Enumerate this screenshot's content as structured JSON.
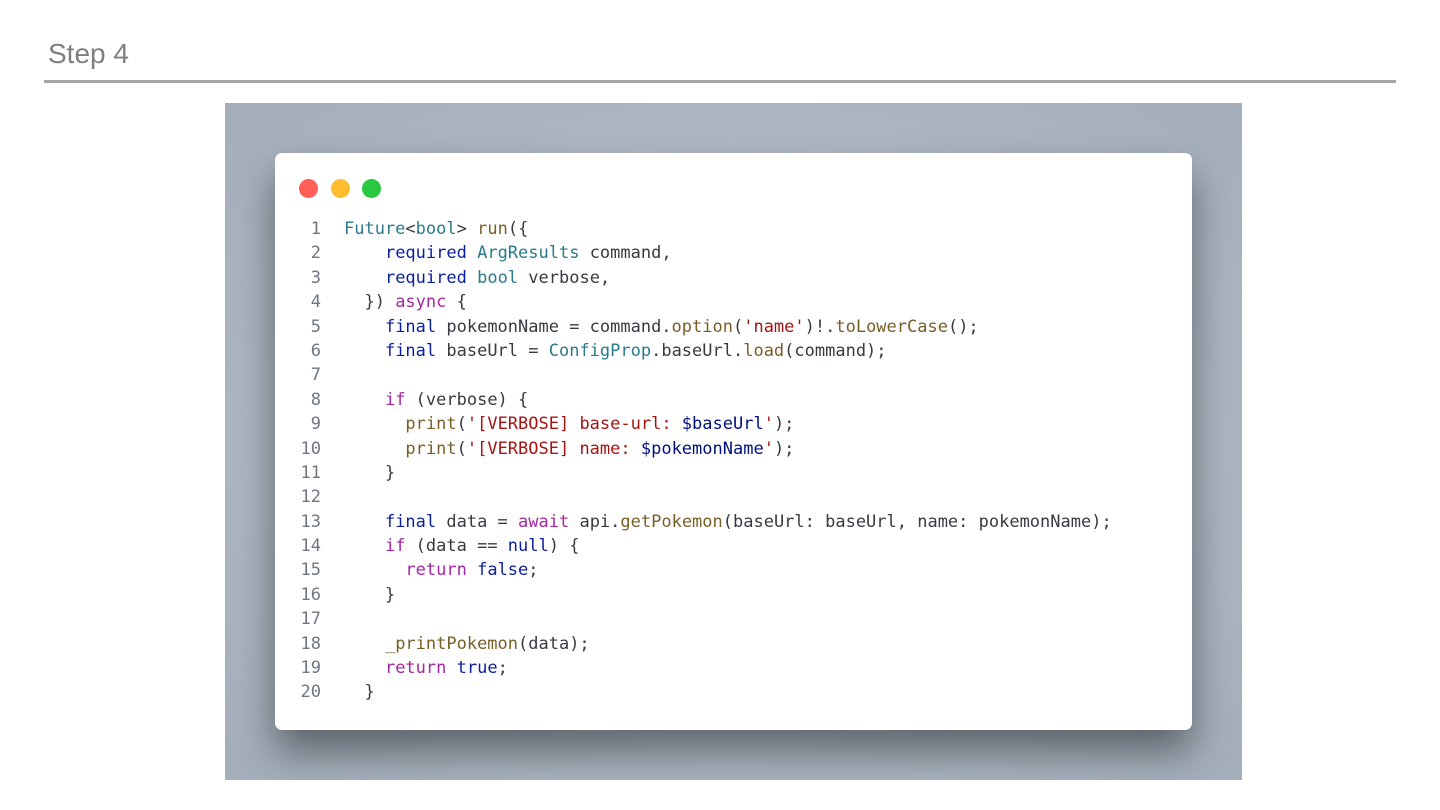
{
  "slide": {
    "title": "Step 4"
  },
  "window": {
    "controls": {
      "close": "#ff5f57",
      "minimize": "#febc2e",
      "maximize": "#28c840"
    }
  },
  "code": {
    "language": "dart",
    "lines": [
      {
        "n": "1",
        "t": [
          [
            "t",
            "Future"
          ],
          [
            "p",
            "<"
          ],
          [
            "t",
            "bool"
          ],
          [
            "p",
            "> "
          ],
          [
            "f",
            "run"
          ],
          [
            "p",
            "({"
          ]
        ]
      },
      {
        "n": "2",
        "t": [
          [
            "p",
            "    "
          ],
          [
            "kb",
            "required"
          ],
          [
            "p",
            " "
          ],
          [
            "t",
            "ArgResults"
          ],
          [
            "p",
            " command,"
          ]
        ]
      },
      {
        "n": "3",
        "t": [
          [
            "p",
            "    "
          ],
          [
            "kb",
            "required"
          ],
          [
            "p",
            " "
          ],
          [
            "t",
            "bool"
          ],
          [
            "p",
            " verbose,"
          ]
        ]
      },
      {
        "n": "4",
        "t": [
          [
            "p",
            "  }) "
          ],
          [
            "k",
            "async"
          ],
          [
            "p",
            " {"
          ]
        ]
      },
      {
        "n": "5",
        "t": [
          [
            "p",
            "    "
          ],
          [
            "kb",
            "final"
          ],
          [
            "p",
            " pokemonName = command."
          ],
          [
            "f",
            "option"
          ],
          [
            "p",
            "("
          ],
          [
            "s",
            "'name'"
          ],
          [
            "p",
            ")!."
          ],
          [
            "f",
            "toLowerCase"
          ],
          [
            "p",
            "();"
          ]
        ]
      },
      {
        "n": "6",
        "t": [
          [
            "p",
            "    "
          ],
          [
            "kb",
            "final"
          ],
          [
            "p",
            " baseUrl = "
          ],
          [
            "t",
            "ConfigProp"
          ],
          [
            "p",
            ".baseUrl."
          ],
          [
            "f",
            "load"
          ],
          [
            "p",
            "(command);"
          ]
        ]
      },
      {
        "n": "7",
        "t": []
      },
      {
        "n": "8",
        "t": [
          [
            "p",
            "    "
          ],
          [
            "k",
            "if"
          ],
          [
            "p",
            " (verbose) {"
          ]
        ]
      },
      {
        "n": "9",
        "t": [
          [
            "p",
            "      "
          ],
          [
            "f",
            "print"
          ],
          [
            "p",
            "("
          ],
          [
            "s",
            "'[VERBOSE] base-url: "
          ],
          [
            "v",
            "$baseUrl"
          ],
          [
            "s",
            "'"
          ],
          [
            "p",
            ");"
          ]
        ]
      },
      {
        "n": "10",
        "t": [
          [
            "p",
            "      "
          ],
          [
            "f",
            "print"
          ],
          [
            "p",
            "("
          ],
          [
            "s",
            "'[VERBOSE] name: "
          ],
          [
            "v",
            "$pokemonName"
          ],
          [
            "s",
            "'"
          ],
          [
            "p",
            ");"
          ]
        ]
      },
      {
        "n": "11",
        "t": [
          [
            "p",
            "    }"
          ]
        ]
      },
      {
        "n": "12",
        "t": []
      },
      {
        "n": "13",
        "t": [
          [
            "p",
            "    "
          ],
          [
            "kb",
            "final"
          ],
          [
            "p",
            " data = "
          ],
          [
            "k",
            "await"
          ],
          [
            "p",
            " api."
          ],
          [
            "f",
            "getPokemon"
          ],
          [
            "p",
            "(baseUrl: baseUrl, name: pokemonName);"
          ]
        ]
      },
      {
        "n": "14",
        "t": [
          [
            "p",
            "    "
          ],
          [
            "k",
            "if"
          ],
          [
            "p",
            " (data == "
          ],
          [
            "kb",
            "null"
          ],
          [
            "p",
            ") {"
          ]
        ]
      },
      {
        "n": "15",
        "t": [
          [
            "p",
            "      "
          ],
          [
            "k",
            "return"
          ],
          [
            "p",
            " "
          ],
          [
            "kb",
            "false"
          ],
          [
            "p",
            ";"
          ]
        ]
      },
      {
        "n": "16",
        "t": [
          [
            "p",
            "    }"
          ]
        ]
      },
      {
        "n": "17",
        "t": []
      },
      {
        "n": "18",
        "t": [
          [
            "p",
            "    "
          ],
          [
            "f",
            "_printPokemon"
          ],
          [
            "p",
            "(data);"
          ]
        ]
      },
      {
        "n": "19",
        "t": [
          [
            "p",
            "    "
          ],
          [
            "k",
            "return"
          ],
          [
            "p",
            " "
          ],
          [
            "kb",
            "true"
          ],
          [
            "p",
            ";"
          ]
        ]
      },
      {
        "n": "20",
        "t": [
          [
            "p",
            "  }"
          ]
        ]
      }
    ]
  }
}
